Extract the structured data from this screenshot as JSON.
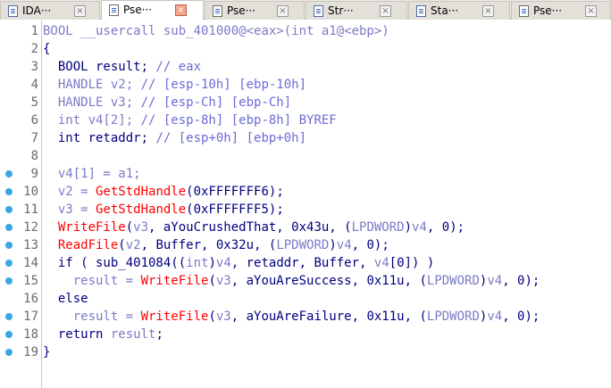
{
  "tabs": [
    {
      "label": "IDA···",
      "icon": "ida-view-icon",
      "active": false
    },
    {
      "label": "Pse···",
      "icon": "pseudocode-icon",
      "active": true
    },
    {
      "label": "Pse···",
      "icon": "pseudocode-icon",
      "active": false
    },
    {
      "label": "Str···",
      "icon": "strings-icon",
      "active": false
    },
    {
      "label": "Sta···",
      "icon": "stack-icon",
      "active": false
    },
    {
      "label": "Pse···",
      "icon": "pseudocode-icon",
      "active": false
    }
  ],
  "close_glyph": "×",
  "code": {
    "lines": [
      {
        "num": "1",
        "breakpoint": false,
        "tokens": [
          {
            "c": "t-grey",
            "t": "BOOL __usercall sub_401000@<eax>(int a1@<ebp>)"
          }
        ]
      },
      {
        "num": "2",
        "breakpoint": false,
        "tokens": [
          {
            "c": "t-default",
            "t": "{"
          }
        ]
      },
      {
        "num": "3",
        "breakpoint": false,
        "tokens": [
          {
            "c": "t-default",
            "t": "  BOOL result; "
          },
          {
            "c": "t-comment",
            "t": "// eax"
          }
        ]
      },
      {
        "num": "4",
        "breakpoint": false,
        "tokens": [
          {
            "c": "t-grey",
            "t": "  HANDLE v2; "
          },
          {
            "c": "t-comment",
            "t": "// [esp-10h] [ebp-10h]"
          }
        ]
      },
      {
        "num": "5",
        "breakpoint": false,
        "tokens": [
          {
            "c": "t-grey",
            "t": "  HANDLE v3; "
          },
          {
            "c": "t-comment",
            "t": "// [esp-Ch] [ebp-Ch]"
          }
        ]
      },
      {
        "num": "6",
        "breakpoint": false,
        "tokens": [
          {
            "c": "t-grey",
            "t": "  int v4[2]; "
          },
          {
            "c": "t-comment",
            "t": "// [esp-8h] [ebp-8h] BYREF"
          }
        ]
      },
      {
        "num": "7",
        "breakpoint": false,
        "tokens": [
          {
            "c": "t-default",
            "t": "  int retaddr; "
          },
          {
            "c": "t-comment",
            "t": "// [esp+0h] [ebp+0h]"
          }
        ]
      },
      {
        "num": "8",
        "breakpoint": false,
        "tokens": [
          {
            "c": "t-default",
            "t": ""
          }
        ]
      },
      {
        "num": "9",
        "breakpoint": true,
        "tokens": [
          {
            "c": "t-grey",
            "t": "  v4[1] = a1;"
          }
        ]
      },
      {
        "num": "10",
        "breakpoint": true,
        "tokens": [
          {
            "c": "t-grey",
            "t": "  v2 = "
          },
          {
            "c": "t-fn",
            "t": "GetStdHandle"
          },
          {
            "c": "t-default",
            "t": "(0xFFFFFFF6);"
          }
        ]
      },
      {
        "num": "11",
        "breakpoint": true,
        "tokens": [
          {
            "c": "t-grey",
            "t": "  v3 = "
          },
          {
            "c": "t-fn",
            "t": "GetStdHandle"
          },
          {
            "c": "t-default",
            "t": "(0xFFFFFFF5);"
          }
        ]
      },
      {
        "num": "12",
        "breakpoint": true,
        "tokens": [
          {
            "c": "t-fn",
            "t": "  WriteFile"
          },
          {
            "c": "t-default",
            "t": "("
          },
          {
            "c": "t-grey",
            "t": "v3"
          },
          {
            "c": "t-default",
            "t": ", aYouCrushedThat, 0x43u, ("
          },
          {
            "c": "t-grey",
            "t": "LPDWORD"
          },
          {
            "c": "t-default",
            "t": ")"
          },
          {
            "c": "t-grey",
            "t": "v4"
          },
          {
            "c": "t-default",
            "t": ", 0);"
          }
        ]
      },
      {
        "num": "13",
        "breakpoint": true,
        "tokens": [
          {
            "c": "t-fn",
            "t": "  ReadFile"
          },
          {
            "c": "t-default",
            "t": "("
          },
          {
            "c": "t-grey",
            "t": "v2"
          },
          {
            "c": "t-default",
            "t": ", Buffer, 0x32u, ("
          },
          {
            "c": "t-grey",
            "t": "LPDWORD"
          },
          {
            "c": "t-default",
            "t": ")"
          },
          {
            "c": "t-grey",
            "t": "v4"
          },
          {
            "c": "t-default",
            "t": ", 0);"
          }
        ]
      },
      {
        "num": "14",
        "breakpoint": true,
        "tokens": [
          {
            "c": "t-default",
            "t": "  if ( sub_401084(("
          },
          {
            "c": "t-grey",
            "t": "int"
          },
          {
            "c": "t-default",
            "t": ")"
          },
          {
            "c": "t-grey",
            "t": "v4"
          },
          {
            "c": "t-default",
            "t": ", retaddr, Buffer, "
          },
          {
            "c": "t-grey",
            "t": "v4"
          },
          {
            "c": "t-default",
            "t": "[0]) )"
          }
        ]
      },
      {
        "num": "15",
        "breakpoint": true,
        "tokens": [
          {
            "c": "t-grey",
            "t": "    result = "
          },
          {
            "c": "t-fn",
            "t": "WriteFile"
          },
          {
            "c": "t-default",
            "t": "("
          },
          {
            "c": "t-grey",
            "t": "v3"
          },
          {
            "c": "t-default",
            "t": ", aYouAreSuccess, 0x11u, ("
          },
          {
            "c": "t-grey",
            "t": "LPDWORD"
          },
          {
            "c": "t-default",
            "t": ")"
          },
          {
            "c": "t-grey",
            "t": "v4"
          },
          {
            "c": "t-default",
            "t": ", 0);"
          }
        ]
      },
      {
        "num": "16",
        "breakpoint": false,
        "tokens": [
          {
            "c": "t-default",
            "t": "  else"
          }
        ]
      },
      {
        "num": "17",
        "breakpoint": true,
        "tokens": [
          {
            "c": "t-grey",
            "t": "    result = "
          },
          {
            "c": "t-fn",
            "t": "WriteFile"
          },
          {
            "c": "t-default",
            "t": "("
          },
          {
            "c": "t-grey",
            "t": "v3"
          },
          {
            "c": "t-default",
            "t": ", aYouAreFailure, 0x11u, ("
          },
          {
            "c": "t-grey",
            "t": "LPDWORD"
          },
          {
            "c": "t-default",
            "t": ")"
          },
          {
            "c": "t-grey",
            "t": "v4"
          },
          {
            "c": "t-default",
            "t": ", 0);"
          }
        ]
      },
      {
        "num": "18",
        "breakpoint": true,
        "tokens": [
          {
            "c": "t-default",
            "t": "  return "
          },
          {
            "c": "t-grey",
            "t": "result"
          },
          {
            "c": "t-default",
            "t": ";"
          }
        ]
      },
      {
        "num": "19",
        "breakpoint": true,
        "tokens": [
          {
            "c": "t-default",
            "t": "}"
          }
        ]
      }
    ]
  },
  "colors": {
    "keyword_navy": "#000080",
    "variable_grey_blue": "#7b7bc8",
    "api_function_red": "#ff0000",
    "comment_blue": "#6b6bd8",
    "breakpoint_dot": "#3aa6e6",
    "active_close_button": "#f2a68d"
  }
}
